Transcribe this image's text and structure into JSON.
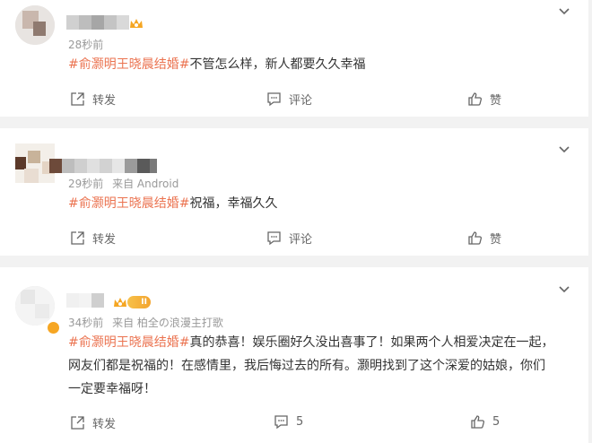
{
  "comments": [
    {
      "time": "28秒前",
      "source": "",
      "tag": "#俞灏明王晓晨结婚#",
      "body": "不管怎么样，新人都要久久幸福",
      "repost_label": "转发",
      "comment_label": "评论",
      "like_label": "赞"
    },
    {
      "time": "29秒前",
      "source": "来自 Android",
      "tag": "#俞灏明王晓晨结婚#",
      "body": "祝福，幸福久久",
      "repost_label": "转发",
      "comment_label": "评论",
      "like_label": "赞"
    },
    {
      "time": "34秒前",
      "source": "来自 柏全の浪漫主打歌",
      "level": "II",
      "tag": "#俞灏明王晓晨结婚#",
      "body_line1": "真的恭喜！娱乐圈好久没出喜事了！如果两个人相爱决定在一起，",
      "body_line2": "网友们都是祝福的！在感情里，我后悔过去的所有。灏明找到了这个深爱的姑娘，你们",
      "body_line3": "一定要幸福呀！",
      "repost_label": "转发",
      "comment_count": "5",
      "like_count": "5"
    }
  ],
  "colors": {
    "tag": "#eb7350",
    "text": "#333333",
    "meta": "#999999",
    "background": "#f2f2f2"
  }
}
